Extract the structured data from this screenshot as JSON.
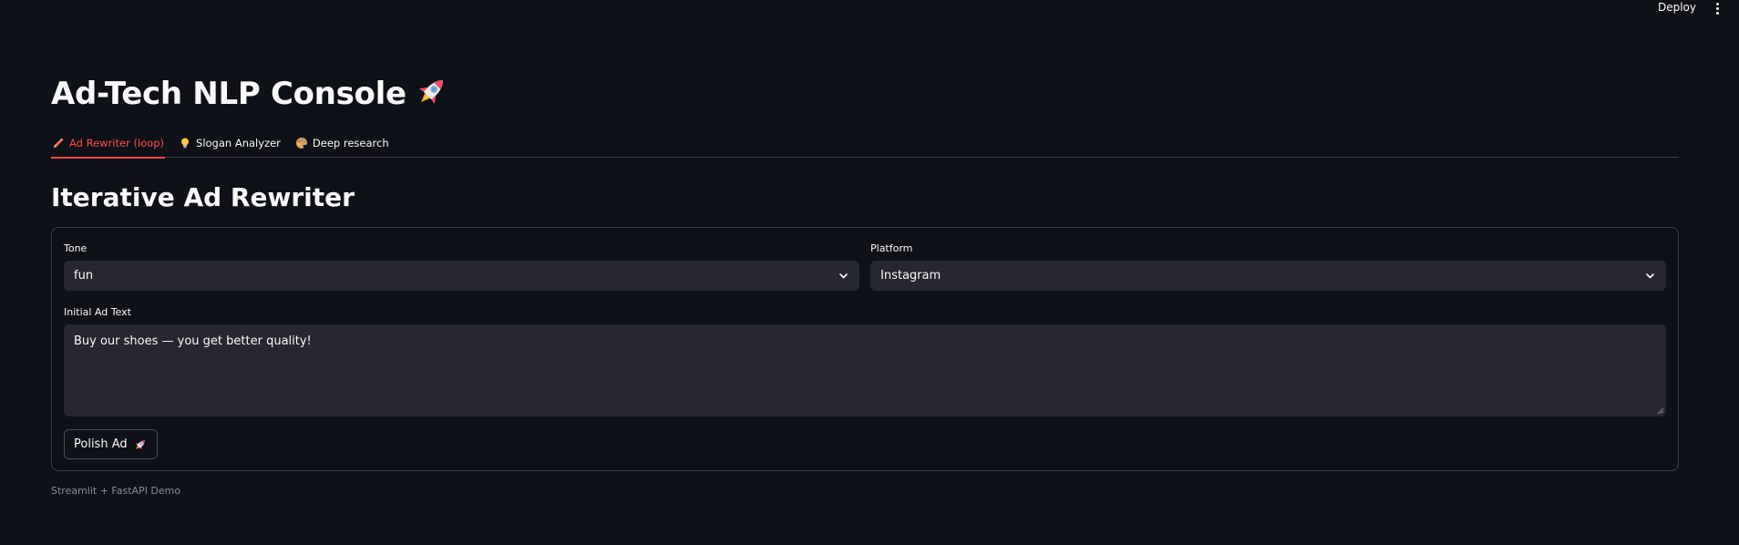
{
  "toolbar": {
    "deploy_label": "Deploy"
  },
  "header": {
    "title": "Ad-Tech NLP Console"
  },
  "tabs": [
    {
      "label": "Ad Rewriter (loop)",
      "icon": "pencil-icon",
      "active": true
    },
    {
      "label": "Slogan Analyzer",
      "icon": "lightbulb-icon",
      "active": false
    },
    {
      "label": "Deep research",
      "icon": "palette-icon",
      "active": false
    }
  ],
  "section": {
    "title": "Iterative Ad Rewriter"
  },
  "form": {
    "tone": {
      "label": "Tone",
      "value": "fun"
    },
    "platform": {
      "label": "Platform",
      "value": "Instagram"
    },
    "ad_text": {
      "label": "Initial Ad Text",
      "value": "Buy our shoes — you get better quality!"
    },
    "submit_label": "Polish Ad"
  },
  "footer": {
    "caption": "Streamlit + FastAPI Demo"
  },
  "colors": {
    "background": "#0e1117",
    "accent": "#ff4b4b",
    "input_bg": "#262730",
    "border": "#3a3d46"
  }
}
